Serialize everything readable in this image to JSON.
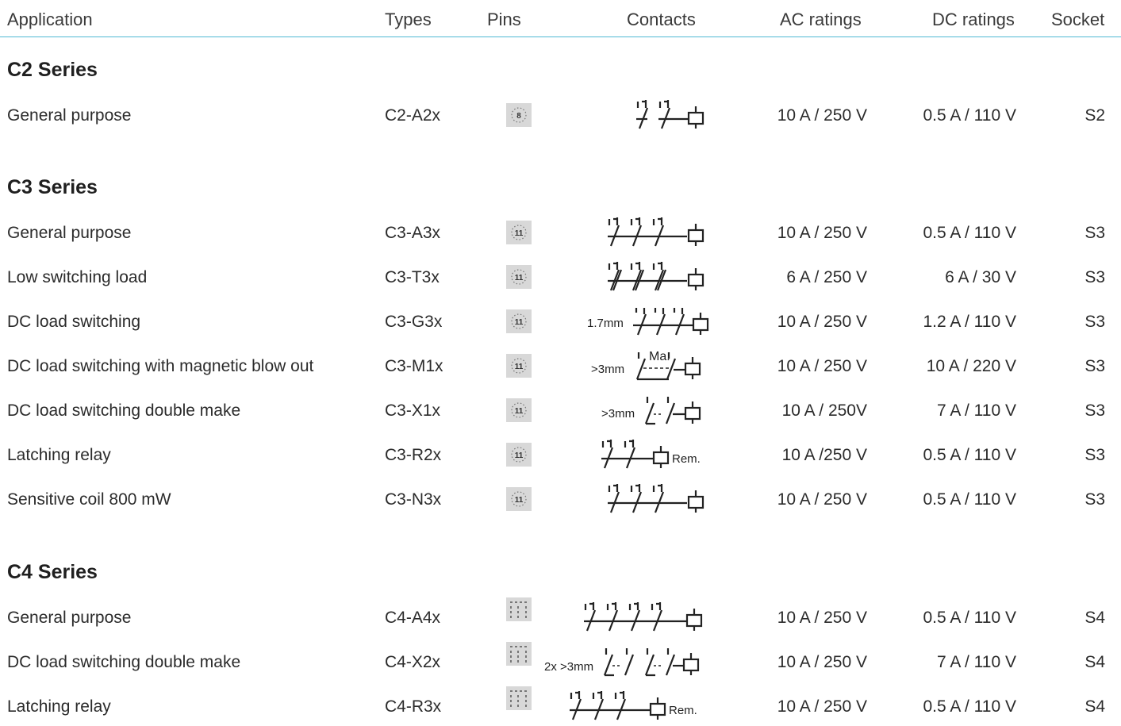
{
  "header": {
    "application": "Application",
    "types": "Types",
    "pins": "Pins",
    "contacts": "Contacts",
    "ac": "AC ratings",
    "dc": "DC ratings",
    "socket": "Socket"
  },
  "series": [
    {
      "title": "C2 Series",
      "rows": [
        {
          "application": "General purpose",
          "type": "C2-A2x",
          "pins": "8",
          "ac": "10 A / 250 V",
          "dc": "0.5 A / 110 V",
          "socket": "S2"
        }
      ]
    },
    {
      "title": "C3 Series",
      "rows": [
        {
          "application": "General purpose",
          "type": "C3-A3x",
          "pins": "11",
          "ac": "10 A / 250 V",
          "dc": "0.5 A / 110 V",
          "socket": "S3"
        },
        {
          "application": "Low switching load",
          "type": "C3-T3x",
          "pins": "11",
          "ac": "6 A / 250 V",
          "dc": "6 A / 30 V",
          "socket": "S3"
        },
        {
          "application": "DC load switching",
          "type": "C3-G3x",
          "pins": "11",
          "contact_label": "1.7mm",
          "ac": "10 A / 250 V",
          "dc": "1.2 A / 110 V",
          "socket": "S3"
        },
        {
          "application": "DC load switching with magnetic blow out",
          "type": "C3-M1x",
          "pins": "11",
          "contact_label": ">3mm",
          "contact_ma": "Ma.",
          "ac": "10 A / 250 V",
          "dc": "10 A / 220 V",
          "socket": "S3"
        },
        {
          "application": "DC load switching double make",
          "type": "C3-X1x",
          "pins": "11",
          "contact_label": ">3mm",
          "ac": "10 A / 250V",
          "dc": "7 A / 110 V",
          "socket": "S3"
        },
        {
          "application": "Latching relay",
          "type": "C3-R2x",
          "pins": "11",
          "contact_rem": "Rem.",
          "ac": "10 A /250 V",
          "dc": "0.5 A / 110 V",
          "socket": "S3"
        },
        {
          "application": "Sensitive coil 800 mW",
          "type": "C3-N3x",
          "pins": "11",
          "ac": "10 A / 250 V",
          "dc": "0.5 A / 110 V",
          "socket": "S3"
        }
      ]
    },
    {
      "title": "C4 Series",
      "rows": [
        {
          "application": "General purpose",
          "type": "C4-A4x",
          "ac": "10 A / 250 V",
          "dc": "0.5 A / 110 V",
          "socket": "S4"
        },
        {
          "application": "DC load switching double make",
          "type": "C4-X2x",
          "contact_label": "2x >3mm",
          "ac": "10 A / 250 V",
          "dc": "7 A / 110 V",
          "socket": "S4"
        },
        {
          "application": "Latching relay",
          "type": "C4-R3x",
          "contact_rem": "Rem.",
          "ac": "10 A / 250 V",
          "dc": "0.5 A / 110 V",
          "socket": "S4"
        }
      ]
    }
  ]
}
